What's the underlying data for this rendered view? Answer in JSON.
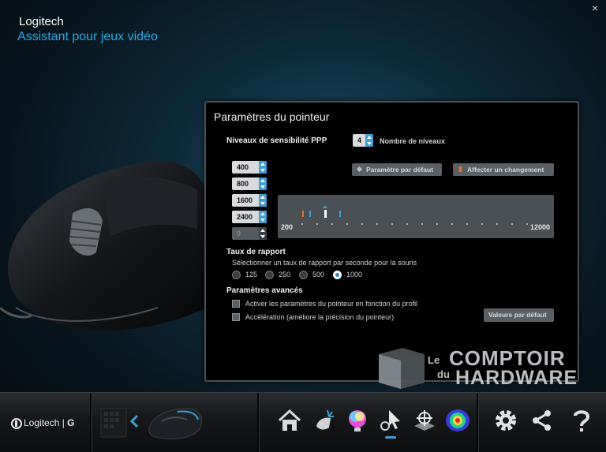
{
  "window": {
    "app_name": "Logitech",
    "subtitle": "Assistant pour jeux vidéo",
    "close": "×"
  },
  "panel": {
    "title": "Paramètres du pointeur",
    "ppp": {
      "section_label": "Niveaux de sensibilité PPP",
      "levels_count": "4",
      "levels_count_label": "Nombre de niveaux",
      "levels": [
        "400",
        "800",
        "1600",
        "2400",
        "0"
      ],
      "default_button": "Paramètre par défaut",
      "assign_button": "Affecter un changement",
      "slider_min": "200",
      "slider_max": "12000"
    },
    "report_rate": {
      "section_label": "Taux de rapport",
      "description": "Sélectionner un taux de rapport par seconde pour la souris",
      "options": [
        "125",
        "250",
        "500",
        "1000"
      ],
      "selected": "1000"
    },
    "advanced": {
      "section_label": "Paramètres avancés",
      "option1": "Activer les paramètres du pointeur en fonction du profil",
      "option2": "Accélération (améliore la précision du pointeur)",
      "defaults_button": "Valeurs par défaut"
    }
  },
  "bottom_bar": {
    "brand": "Logitech",
    "icons": [
      "home-icon",
      "pointer-assign-icon",
      "lighting-icon",
      "pointer-settings-icon",
      "surface-tuning-icon",
      "heatmap-icon",
      "settings-icon",
      "share-icon",
      "help-icon"
    ]
  },
  "watermark": {
    "line1": "Le",
    "line2": "COMPTOIR",
    "line3": "du",
    "line4": "HARDWARE"
  },
  "colors": {
    "accent": "#2aa9e6",
    "orange": "#e8732a",
    "marker_blue": "#3fa0d8"
  }
}
